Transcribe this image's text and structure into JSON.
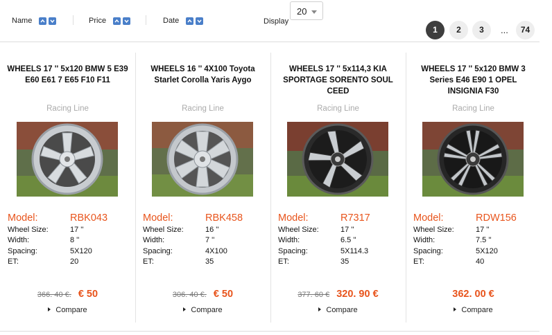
{
  "toolbar": {
    "sort": [
      {
        "label": "Name"
      },
      {
        "label": "Price"
      },
      {
        "label": "Date"
      }
    ],
    "display_label": "Display",
    "display_value": "20"
  },
  "pagination": {
    "pages": [
      "1",
      "2",
      "3"
    ],
    "ellipsis": "...",
    "last": "74",
    "active": "1"
  },
  "labels": {
    "model": "Model:",
    "wheel_size": "Wheel Size:",
    "width": "Width:",
    "spacing": "Spacing:",
    "et": "ET:",
    "compare": "Compare"
  },
  "products": [
    {
      "title": "WHEELS 17 '' 5x120 BMW 5 E39 E60 E61 7 E65 F10 F11",
      "brand": "Racing Line",
      "model": "RBK043",
      "wheel_size": "17 ''",
      "width": "8 ''",
      "spacing": "5X120",
      "et": "20",
      "old_price": "366. 40 €.",
      "new_price": "€ 50",
      "wheel_style": "silver-5-spoke"
    },
    {
      "title": "WHEELS 16 '' 4X100 Toyota Starlet Corolla Yaris Aygo",
      "brand": "Racing Line",
      "model": "RBK458",
      "wheel_size": "16 ''",
      "width": "7 ''",
      "spacing": "4X100",
      "et": "35",
      "old_price": "306. 40 €.",
      "new_price": "€ 50",
      "wheel_style": "silver-6-spoke"
    },
    {
      "title": "WHEELS 17 '' 5x114,3 KIA SPORTAGE SORENTO SOUL CEED",
      "brand": "Racing Line",
      "model": "R7317",
      "wheel_size": "17 ''",
      "width": "6.5 ''",
      "spacing": "5X114.3",
      "et": "35",
      "old_price": "377. 60 €",
      "new_price": "320. 90 €",
      "wheel_style": "black-polished"
    },
    {
      "title": "WHEELS 17 '' 5x120 BMW 3 Series E46 E90 1 OPEL INSIGNIA F30",
      "brand": "Racing Line",
      "model": "RDW156",
      "wheel_size": "17 ''",
      "width": "7.5 ''",
      "spacing": "5X120",
      "et": "40",
      "old_price": "",
      "new_price": "362. 00 €",
      "wheel_style": "black-polished-split"
    }
  ],
  "colors": {
    "accent": "#e8541c",
    "sort_button": "#4a7fc9",
    "page_active": "#3e3e3e"
  }
}
